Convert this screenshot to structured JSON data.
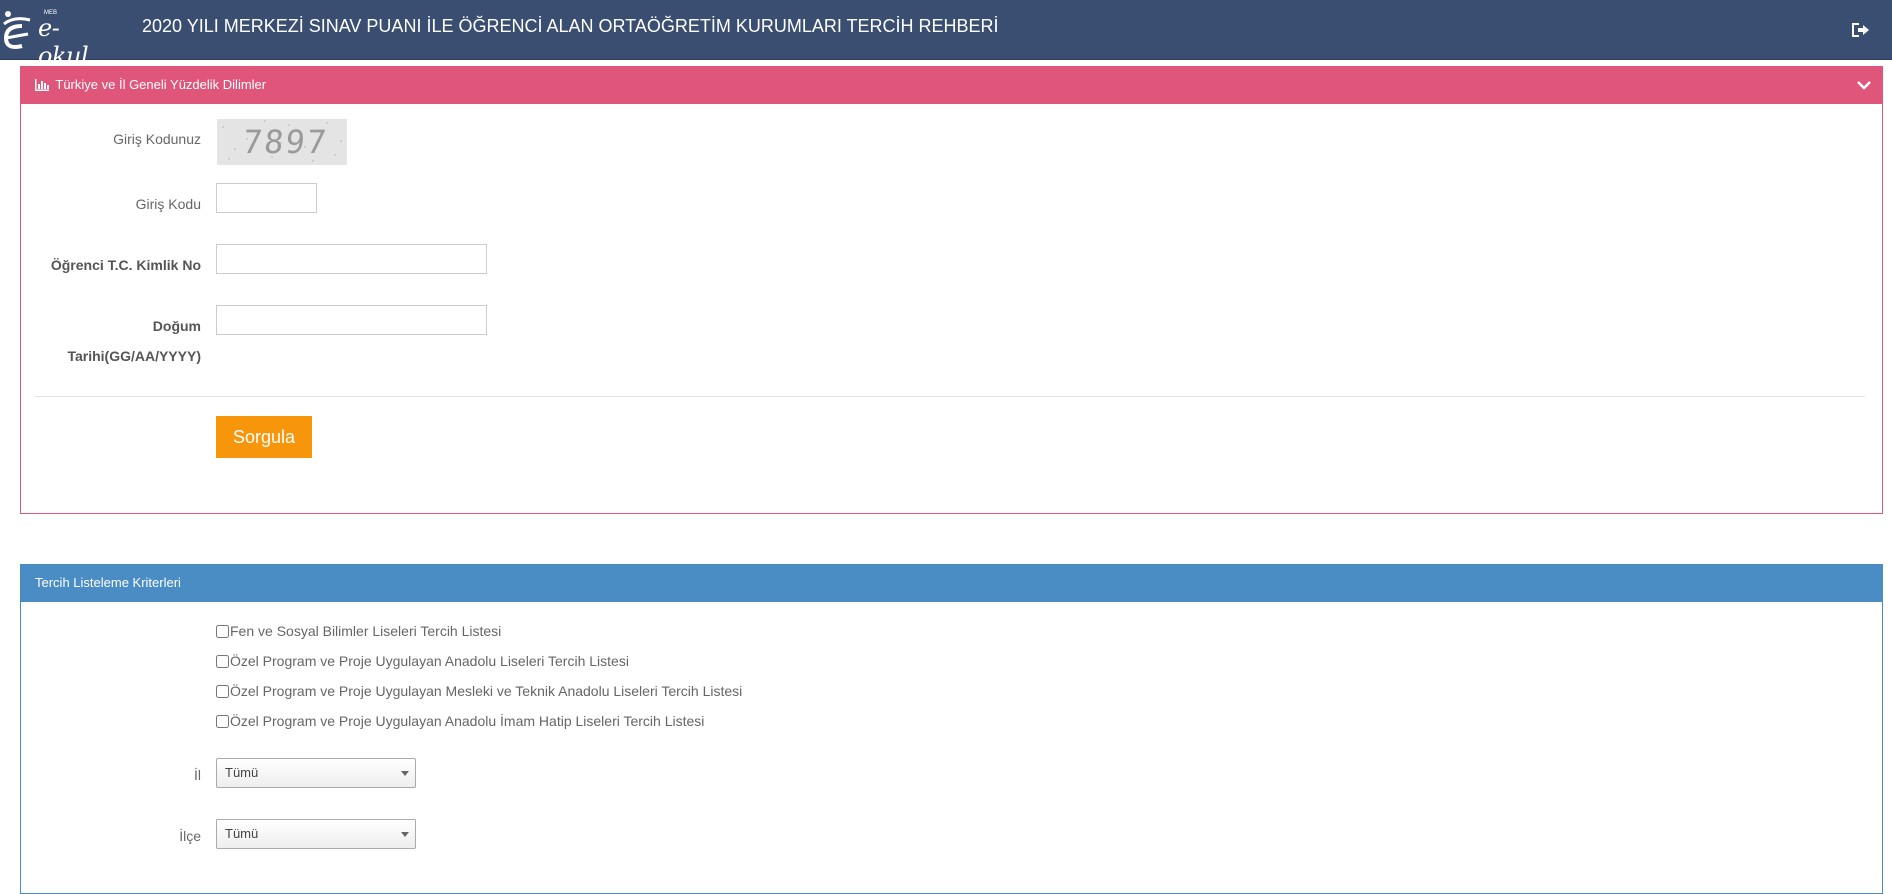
{
  "navbar": {
    "logo_text": "e-okul",
    "logo_small": "MEB",
    "title": "2020 YILI MERKEZİ SINAV PUANI İLE ÖĞRENCİ ALAN ORTAÖĞRETİM KURUMLARI TERCİH REHBERİ",
    "logout_icon": "sign-out-icon"
  },
  "panel_percentile": {
    "title": "Türkiye ve İl Geneli Yüzdelik Dilimler",
    "title_icon": "bar-chart-icon",
    "toggle_icon": "chevron-down-icon",
    "accent": "#e0567b",
    "captcha_label": "Giriş Kodunuz",
    "captcha_value": "7897",
    "code_label": "Giriş Kodu",
    "code_value": "",
    "tc_label": "Öğrenci T.C. Kimlik No",
    "tc_value": "",
    "birth_label_line1": "Doğum",
    "birth_label_line2": "Tarihi(GG/AA/YYYY)",
    "birth_value": "",
    "submit_label": "Sorgula",
    "submit_color": "#f7960b"
  },
  "panel_criteria": {
    "title": "Tercih Listeleme Kriterleri",
    "accent": "#4a8cc4",
    "checkboxes": [
      {
        "label": "Fen ve Sosyal Bilimler Liseleri Tercih Listesi",
        "checked": false
      },
      {
        "label": "Özel Program ve Proje Uygulayan Anadolu Liseleri Tercih Listesi",
        "checked": false
      },
      {
        "label": "Özel Program ve Proje Uygulayan Mesleki ve Teknik Anadolu Liseleri Tercih Listesi",
        "checked": false
      },
      {
        "label": "Özel Program ve Proje Uygulayan Anadolu İmam Hatip Liseleri Tercih Listesi",
        "checked": false
      }
    ],
    "il_label": "İl",
    "il_selected": "Tümü",
    "ilce_label": "İlçe",
    "ilce_selected": "Tümü"
  }
}
